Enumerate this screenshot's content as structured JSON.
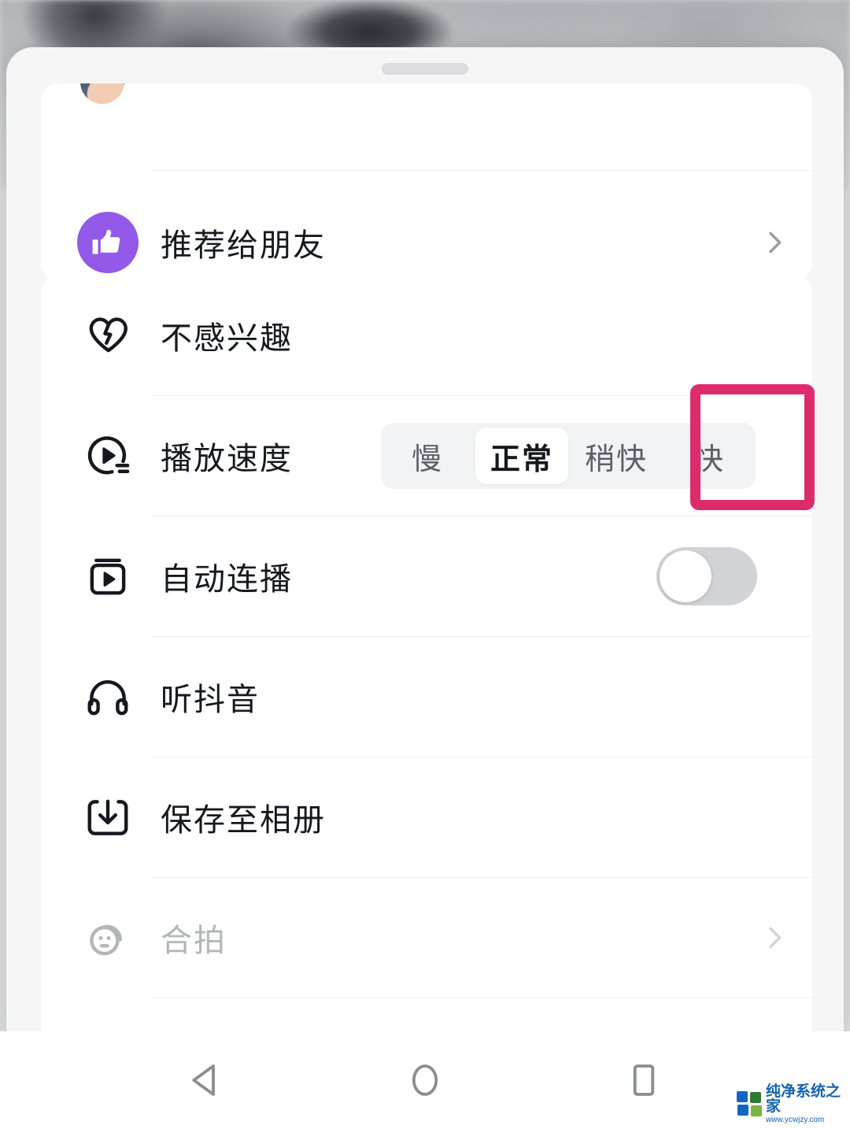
{
  "app": {
    "name": "Douyin",
    "screen": "video-share-sheet"
  },
  "backdrop": {
    "description": "blurred greyscale video frame"
  },
  "sheet": {
    "drag_handle": "drag-handle"
  },
  "top_card": {
    "rows": [
      {
        "id": "recommend-to-friends",
        "icon": "thumbs-up-icon",
        "icon_bg": "#9359e8",
        "label": "推荐给朋友",
        "accessory": "chevron-right-icon"
      }
    ]
  },
  "main_card": {
    "rows": [
      {
        "id": "not-interested",
        "icon": "broken-heart-icon",
        "label": "不感兴趣",
        "accessory": "none"
      },
      {
        "id": "playback-speed",
        "icon": "play-speed-icon",
        "label": "播放速度",
        "accessory": "segmented-control"
      },
      {
        "id": "auto-play-next",
        "icon": "video-play-icon",
        "label": "自动连播",
        "accessory": "toggle"
      },
      {
        "id": "listen-to-douyin",
        "icon": "headphones-icon",
        "label": "听抖音",
        "accessory": "none"
      },
      {
        "id": "save-to-album",
        "icon": "download-icon",
        "label": "保存至相册",
        "accessory": "none"
      },
      {
        "id": "duet",
        "icon": "duet-face-icon",
        "label": "合拍",
        "accessory": "chevron-right-icon",
        "disabled": true
      }
    ]
  },
  "speed_control": {
    "name": "playback-speed-segmented-control",
    "options": [
      {
        "value": "slow",
        "label": "慢",
        "selected": false
      },
      {
        "value": "normal",
        "label": "正常",
        "selected": true
      },
      {
        "value": "slightly-fast",
        "label": "稍快",
        "selected": false
      },
      {
        "value": "fast",
        "label": "快",
        "selected": false
      }
    ],
    "selected": "正常"
  },
  "auto_play_toggle": {
    "name": "auto-play-toggle",
    "state": "off",
    "track_color": "#d2d3d6",
    "knob_color": "#ffffff"
  },
  "annotation": {
    "name": "highlight-box",
    "color": "#dd2c6e",
    "targets": "快",
    "shape": "rounded-rectangle"
  },
  "navbar": {
    "buttons": [
      {
        "id": "back",
        "icon": "back-triangle-icon"
      },
      {
        "id": "home",
        "icon": "home-circle-icon"
      },
      {
        "id": "recents",
        "icon": "recents-square-icon"
      }
    ],
    "color": "#8a8d92"
  },
  "watermark": {
    "title": "纯净系统之家",
    "url": "www.ycwjzy.com",
    "colors": {
      "text": "#1462ad",
      "blue": "#1565c0",
      "green": "#7cb342"
    }
  }
}
